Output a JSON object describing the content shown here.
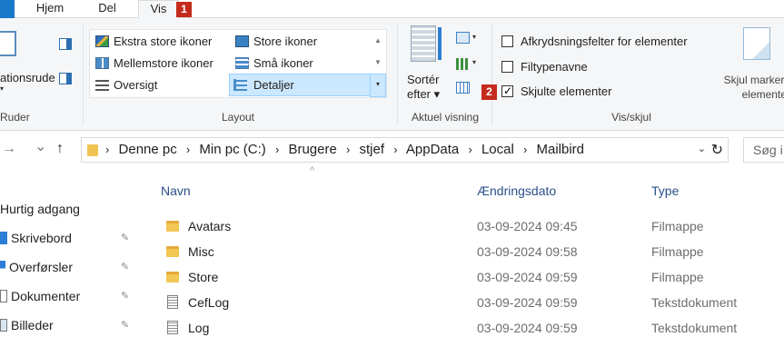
{
  "tabs": {
    "hjem": "Hjem",
    "del": "Del",
    "vis": "Vis"
  },
  "callouts": {
    "one": "1",
    "two": "2"
  },
  "ribbon": {
    "ruder": {
      "nav_pane_label": "ationsrude",
      "nav_pane_arrow": "▾",
      "group_label": "Ruder"
    },
    "layout": {
      "items": [
        "Ekstra store ikoner",
        "Mellemstore ikoner",
        "Oversigt",
        "Store ikoner",
        "Små ikoner",
        "Detaljer"
      ],
      "selected": "Detaljer",
      "group_label": "Layout"
    },
    "current_view": {
      "sort_label_line1": "Sortér",
      "sort_label_line2": "efter ▾",
      "group_label": "Aktuel visning"
    },
    "show_hide": {
      "checkbox_1": "Afkrydsningsfelter for elementer",
      "checkbox_2": "Filtypenavne",
      "checkbox_3": "Skjulte elementer",
      "checkbox_1_checked": false,
      "checkbox_2_checked": false,
      "checkbox_3_checked": true,
      "hide_selected_line1": "Skjul markere",
      "hide_selected_line2": "elementer",
      "group_label": "Vis/skjul"
    }
  },
  "address": {
    "back": "→",
    "history": "⌄",
    "up": "↑",
    "crumbs": [
      "Denne pc",
      "Min pc (C:)",
      "Brugere",
      "stjef",
      "AppData",
      "Local",
      "Mailbird"
    ],
    "crumb_separator": "›",
    "dropdown": "⌄",
    "refresh": "↻",
    "search_placeholder": "Søg i"
  },
  "nav_pane": {
    "items": [
      {
        "label": "Hurtig adgang",
        "icon": "star-icon",
        "pinned": false
      },
      {
        "label": "Skrivebord",
        "icon": "desktop-icon",
        "pinned": true
      },
      {
        "label": "Overførsler",
        "icon": "download-icon",
        "pinned": true
      },
      {
        "label": "Dokumenter",
        "icon": "documents-icon",
        "pinned": true
      },
      {
        "label": "Billeder",
        "icon": "pictures-icon",
        "pinned": true
      }
    ],
    "pin_glyph": "📌"
  },
  "file_list": {
    "sort_caret": "^",
    "columns": {
      "name": "Navn",
      "date": "Ændringsdato",
      "type": "Type"
    },
    "rows": [
      {
        "name": "Avatars",
        "date": "03-09-2024 09:45",
        "type": "Filmappe",
        "icon": "folder-icon"
      },
      {
        "name": "Misc",
        "date": "03-09-2024 09:58",
        "type": "Filmappe",
        "icon": "folder-icon"
      },
      {
        "name": "Store",
        "date": "03-09-2024 09:59",
        "type": "Filmappe",
        "icon": "folder-icon"
      },
      {
        "name": "CefLog",
        "date": "03-09-2024 09:59",
        "type": "Tekstdokument",
        "icon": "text-document-icon"
      },
      {
        "name": "Log",
        "date": "03-09-2024 09:59",
        "type": "Tekstdokument",
        "icon": "text-document-icon"
      }
    ]
  },
  "colors": {
    "accent": "#1979ca",
    "selection": "#cce8ff",
    "callout": "#c42b1c",
    "column_header": "#2a4f8a"
  }
}
